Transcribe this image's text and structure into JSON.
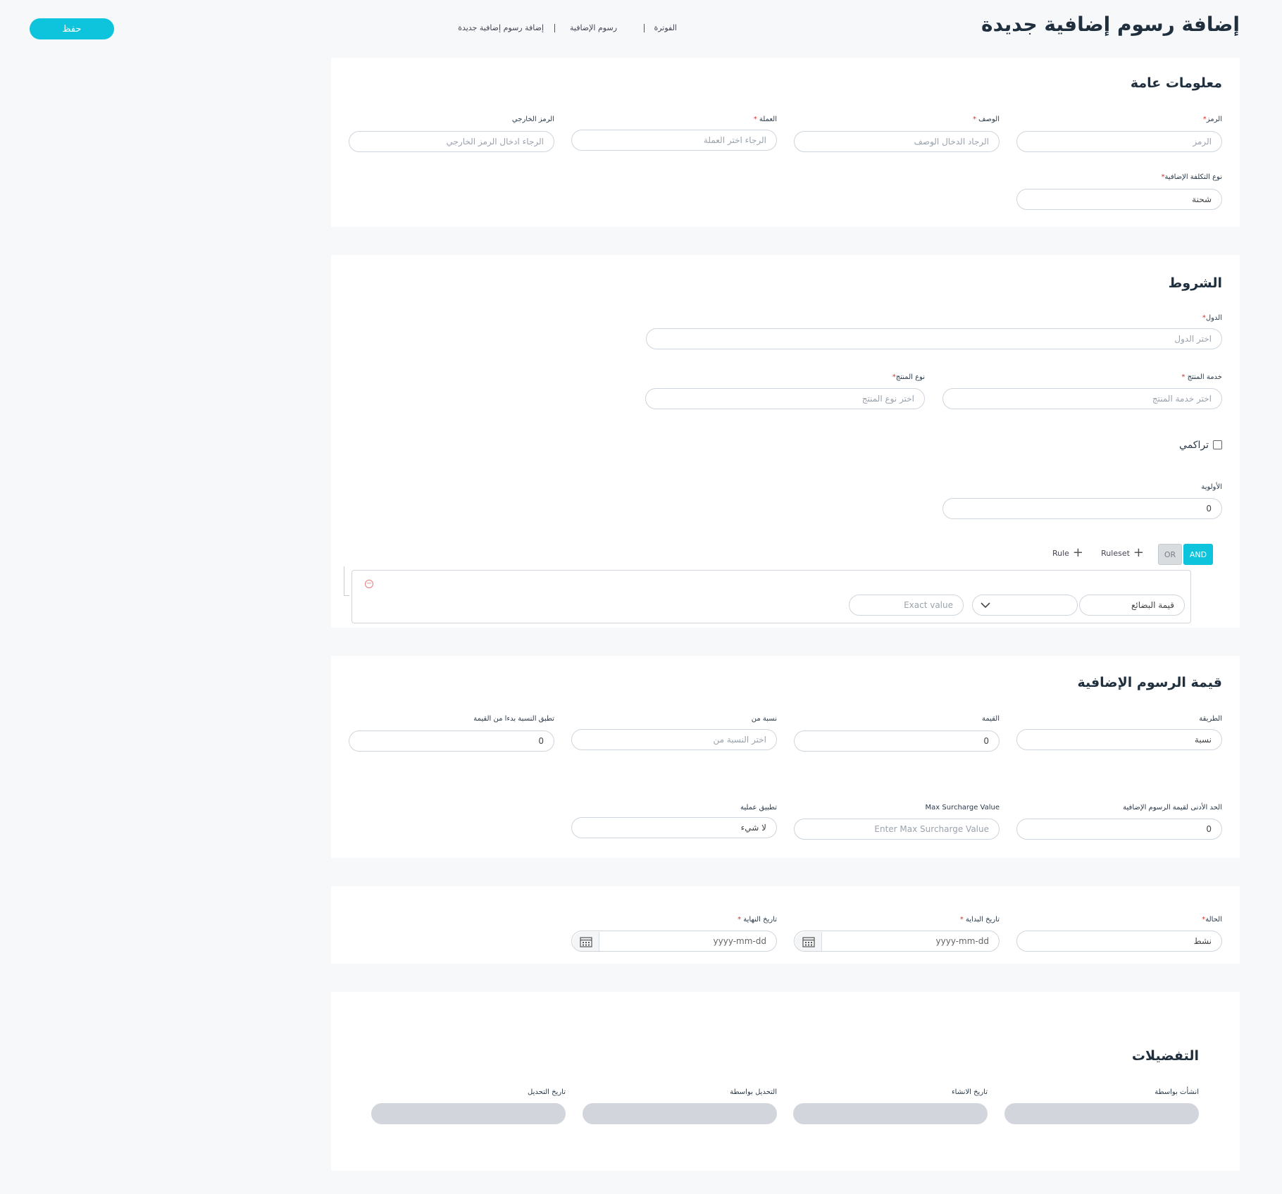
{
  "header": {
    "title": "إضافة رسوم إضافية جديدة",
    "save_label": "حفظ",
    "breadcrumb": [
      "الفوترة",
      "رسوم الإضافية",
      "إضافة رسوم إضافية جديدة"
    ]
  },
  "general": {
    "title": "معلومات عامة",
    "code": {
      "label": "الرمز",
      "required": "*",
      "placeholder": "الرمز"
    },
    "description": {
      "label": "الوصف",
      "required": "*",
      "placeholder": "الرجاد الدخال الوصف"
    },
    "currency": {
      "label": "العملة",
      "required": "*",
      "placeholder": "الرجاء اختر العملة"
    },
    "external_code": {
      "label": "الرمز الخارجي",
      "placeholder": "الرجاء ادخال الرمز الخارجي"
    },
    "surcharge_type": {
      "label": "نوع التكلفة الإضافية",
      "required": "*",
      "value": "شحنة"
    }
  },
  "conditions": {
    "title": "الشروط",
    "countries": {
      "label": "الدول",
      "required": "*",
      "placeholder": "اختر الدول"
    },
    "product_service": {
      "label": "خدمة المنتج",
      "required": "*",
      "placeholder": "اختر خدمة المنتج"
    },
    "product_type": {
      "label": "نوع المنتج",
      "required": "*",
      "placeholder": "اختر نوع المنتج"
    },
    "cumulative_label": "تراكمي",
    "priority": {
      "label": "الأولوية",
      "value": "0"
    },
    "query_builder": {
      "and_label": "AND",
      "or_label": "OR",
      "add_ruleset_label": "Ruleset",
      "add_rule_label": "Rule",
      "rule": {
        "field": "قيمة البضائع",
        "operator": "",
        "value_placeholder": "Exact value"
      }
    }
  },
  "value": {
    "title": "قيمة الرسوم الإضافية",
    "method": {
      "label": "الطريقة",
      "value": "نسبة"
    },
    "amount": {
      "label": "القيمة",
      "value": "0"
    },
    "percentage_of": {
      "label": "نسبة من",
      "placeholder": "اختر النسبة من"
    },
    "apply_from": {
      "label": "تطبق النسبة بدءا من القيمة",
      "value": "0"
    },
    "min_value": {
      "label": "الحد الأدنى لقيمة الرسوم الإضافية",
      "value": "0"
    },
    "max_value": {
      "label": "Max Surcharge Value",
      "placeholder": "Enter Max Surcharge Value"
    },
    "apply_process": {
      "label": "تطبيق عملية",
      "value": "لا شيء"
    }
  },
  "status_section": {
    "status": {
      "label": "الحالة",
      "required": "*",
      "value": "نشط"
    },
    "start_date": {
      "label": "تاريخ البداية",
      "required": "*",
      "placeholder": "yyyy-mm-dd"
    },
    "end_date": {
      "label": "تاريخ النهاية",
      "required": "*",
      "placeholder": "yyyy-mm-dd"
    }
  },
  "details": {
    "title": "التفضيلات",
    "created_by": "انشأت بواسطة",
    "created_date": "تاريخ الانشاء",
    "modified_by": "التحديل بواسطة",
    "modified_date": "تاريخ التحديل"
  }
}
